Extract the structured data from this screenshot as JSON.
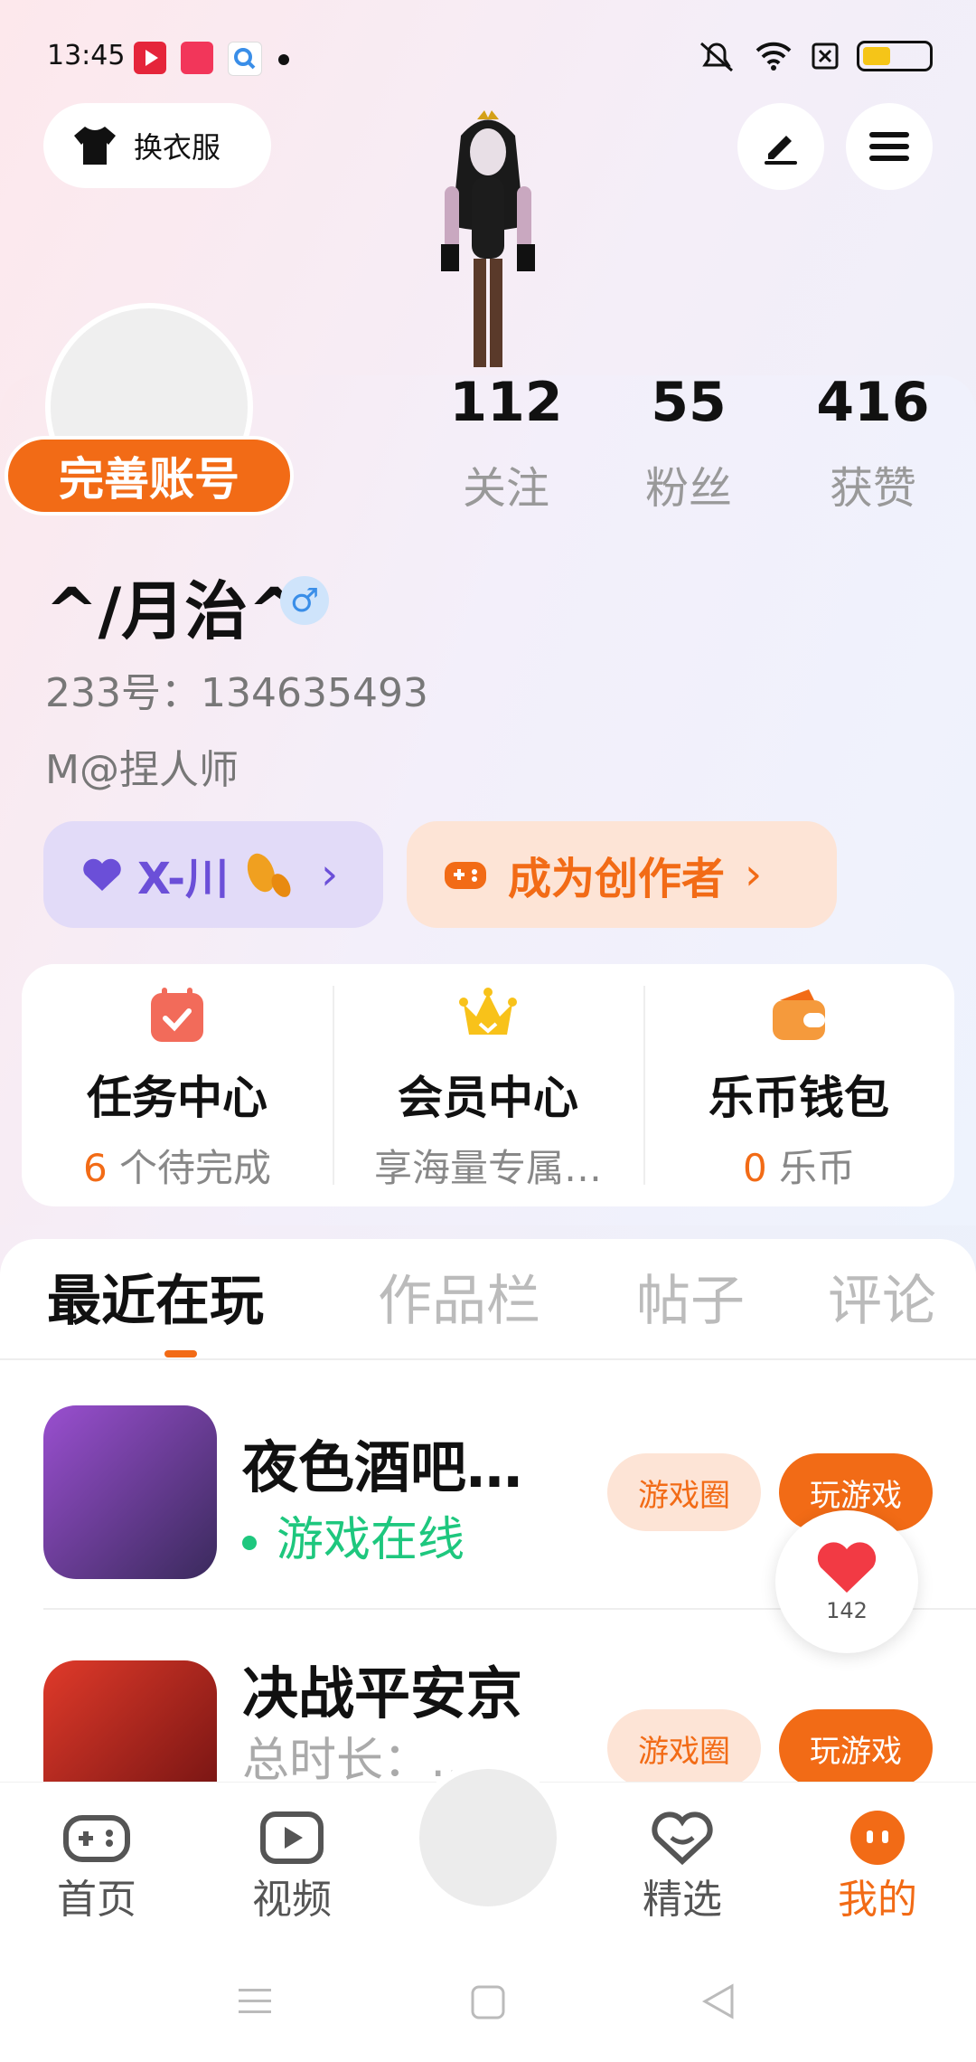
{
  "status_bar": {
    "time": "13:45"
  },
  "header": {
    "dress_label": "换衣服"
  },
  "profile": {
    "complete_label": "完善账号",
    "stats": [
      {
        "value": "112",
        "label": "关注"
      },
      {
        "value": "55",
        "label": "粉丝"
      },
      {
        "value": "416",
        "label": "获赞"
      }
    ],
    "nickname": "^/月治^",
    "gender_symbol": "♂",
    "uid": "233号：134635493",
    "bio": "M@捏人师",
    "vip_label": "X-川",
    "creator_label": "成为创作者",
    "chevron": "›"
  },
  "quick_menu": [
    {
      "title": "任务中心",
      "sub_highlight": "6",
      "sub": " 个待完成"
    },
    {
      "title": "会员中心",
      "sub_highlight": "",
      "sub": "享海量专属…"
    },
    {
      "title": "乐币钱包",
      "sub_highlight": "0",
      "sub": " 乐币"
    }
  ],
  "tabs": [
    "最近在玩",
    "作品栏",
    "帖子",
    "评论"
  ],
  "games": [
    {
      "title": "夜色酒吧…",
      "status": "游戏在线",
      "circle_label": "游戏圈",
      "play_label": "玩游戏"
    },
    {
      "title": "决战平安京",
      "status": "总时长：…",
      "circle_label": "游戏圈",
      "play_label": "玩游戏"
    }
  ],
  "likes_bubble": {
    "count": "142"
  },
  "bottom_nav": [
    {
      "label": "首页",
      "icon": "gamepad-icon"
    },
    {
      "label": "视频",
      "icon": "video-play-icon"
    },
    {
      "label": "精选",
      "icon": "heart-chat-icon"
    },
    {
      "label": "我的",
      "icon": "profile-face-icon"
    }
  ],
  "colors": {
    "accent": "#f26b16",
    "vip": "#6b4fd8",
    "online": "#1ec77e"
  }
}
